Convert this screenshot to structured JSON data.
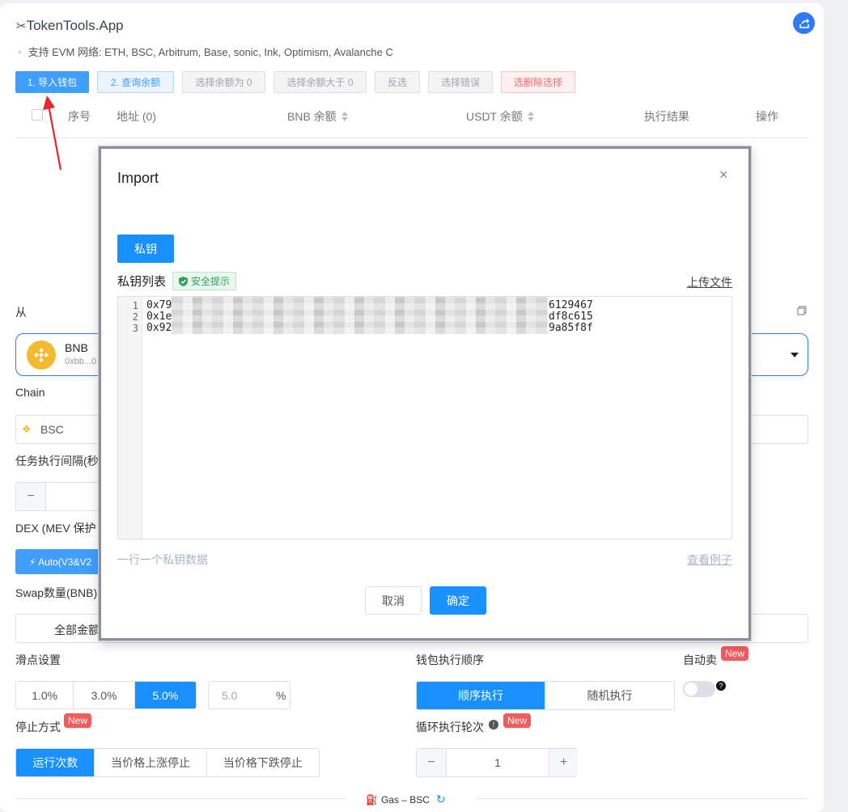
{
  "app": {
    "title": "TokenTools.App",
    "subtitle": "支持 EVM 网络: ETH, BSC, Arbitrum, Base, sonic, Ink, Optimism, Avalanche C"
  },
  "toolbar": {
    "import_wallet": "1. 导入钱包",
    "query_balance": "2. 查询余额",
    "select_zero": "选择余额为 0",
    "select_gt_zero": "选择余额大于 0",
    "invert": "反选",
    "select_error": "选择错误",
    "delete_selected": "选删除选择"
  },
  "table": {
    "col_index": "序号",
    "col_address": "地址 (0)",
    "col_bnb": "BNB 余额",
    "col_usdt": "USDT 余额",
    "col_result": "执行结果",
    "col_action": "操作"
  },
  "form": {
    "from_label": "从",
    "token_name": "BNB",
    "token_address": "0xbb...0",
    "chain_label": "Chain",
    "chain_value": "BSC",
    "interval_label": "任务执行间隔(秒",
    "dex_label": "DEX (MEV 保护",
    "dex_option": "⚡ Auto(V3&V2",
    "swap_label": "Swap数量(BNB)",
    "all_amount": "全部金额",
    "slippage_label": "滑点设置",
    "slippage_options": [
      "1.0%",
      "3.0%",
      "5.0%"
    ],
    "slippage_custom": "5.0",
    "percent": "%",
    "order_label": "钱包执行顺序",
    "order_options": [
      "顺序执行",
      "随机执行"
    ],
    "auto_sell_label": "自动卖",
    "new_badge": "New",
    "stop_label": "停止方式",
    "stop_options": [
      "运行次数",
      "当价格上涨停止",
      "当价格下跌停止"
    ],
    "loop_label": "循环执行轮次",
    "loop_value": "1",
    "minus": "−",
    "plus": "+",
    "gas_label": "Gas – BSC"
  },
  "modal": {
    "title": "Import",
    "close": "×",
    "tab_private_key": "私钥",
    "list_label": "私钥列表",
    "safe_tip": "安全提示",
    "upload_file": "上传文件",
    "lines": [
      {
        "num": "1",
        "start": "0x79",
        "end": "6129467"
      },
      {
        "num": "2",
        "start": "0x1e",
        "end": "df8c615"
      },
      {
        "num": "3",
        "start": "0x92",
        "end": "9a85f8f"
      }
    ],
    "hint": "一行一个私钥数据",
    "view_example": "查看例子",
    "cancel": "取消",
    "confirm": "确定"
  },
  "colors": {
    "primary": "#1890ff",
    "button_blue": "#409eff",
    "danger": "#f56c6c",
    "badge_red": "#f25c5c",
    "annotation_arrow": "#e8262b"
  }
}
